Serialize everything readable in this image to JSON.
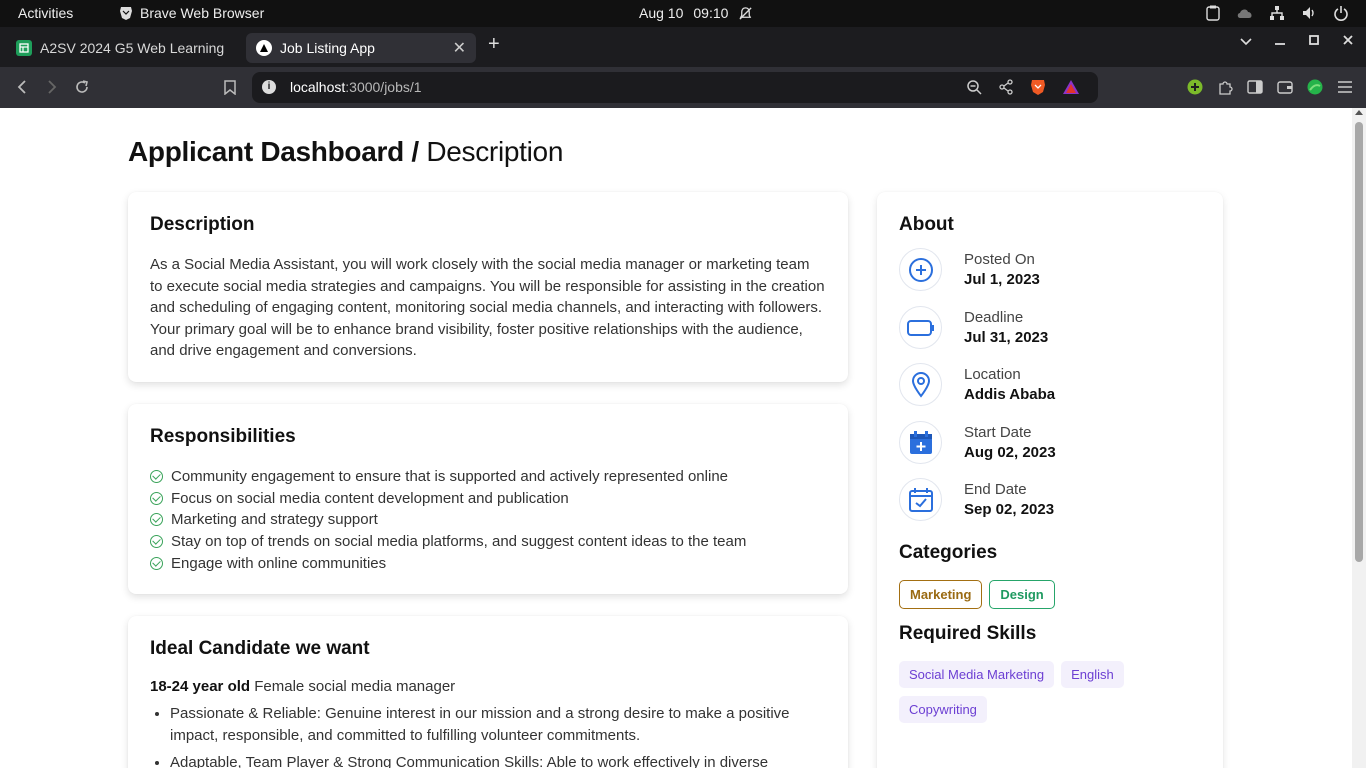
{
  "system_bar": {
    "activities": "Activities",
    "app_name": "Brave Web Browser",
    "date": "Aug 10",
    "time": "09:10"
  },
  "browser": {
    "tabs": [
      {
        "title": "A2SV 2024 G5 Web Learning",
        "icon": "sheets-icon",
        "active": false
      },
      {
        "title": "Job Listing App",
        "icon": "vercel-icon",
        "active": true
      }
    ],
    "url_host": "localhost",
    "url_path": ":3000/jobs/1"
  },
  "page": {
    "heading_bold": "Applicant Dashboard /",
    "heading_light": "Description",
    "description": {
      "title": "Description",
      "text": "As a Social Media Assistant, you will work closely with the social media manager or marketing team to execute social media strategies and campaigns. You will be responsible for assisting in the creation and scheduling of engaging content, monitoring social media channels, and interacting with followers. Your primary goal will be to enhance brand visibility, foster positive relationships with the audience, and drive engagement and conversions."
    },
    "responsibilities": {
      "title": "Responsibilities",
      "items": [
        "Community engagement to ensure that is supported and actively represented online",
        "Focus on social media content development and publication",
        "Marketing and strategy support",
        "Stay on top of trends on social media platforms, and suggest content ideas to the team",
        "Engage with online communities"
      ]
    },
    "ideal": {
      "title": "Ideal Candidate we want",
      "age": "18-24 year old",
      "role": "Female social media manager",
      "traits": [
        "Passionate & Reliable: Genuine interest in our mission and a strong desire to make a positive impact, responsible, and committed to fulfilling volunteer commitments.",
        "Adaptable, Team Player & Strong Communication Skills: Able to work effectively in diverse"
      ]
    },
    "about": {
      "title": "About",
      "items": [
        {
          "label": "Posted On",
          "value": "Jul 1, 2023",
          "icon": "plus-circle-icon"
        },
        {
          "label": "Deadline",
          "value": "Jul 31, 2023",
          "icon": "battery-icon"
        },
        {
          "label": "Location",
          "value": "Addis Ababa",
          "icon": "location-pin-icon"
        },
        {
          "label": "Start Date",
          "value": "Aug 02, 2023",
          "icon": "calendar-plus-icon"
        },
        {
          "label": "End Date",
          "value": "Sep 02, 2023",
          "icon": "calendar-check-icon"
        }
      ]
    },
    "categories": {
      "title": "Categories",
      "items": [
        "Marketing",
        "Design"
      ]
    },
    "skills": {
      "title": "Required Skills",
      "items": [
        "Social Media Marketing",
        "English",
        "Copywriting"
      ]
    }
  },
  "colors": {
    "accent_blue": "#2b6fdd",
    "check_green": "#3aa35a",
    "marketing": "#a36f12",
    "design": "#26a56a",
    "skill_text": "#6c3fd3",
    "skill_bg": "#f3f0fc"
  }
}
